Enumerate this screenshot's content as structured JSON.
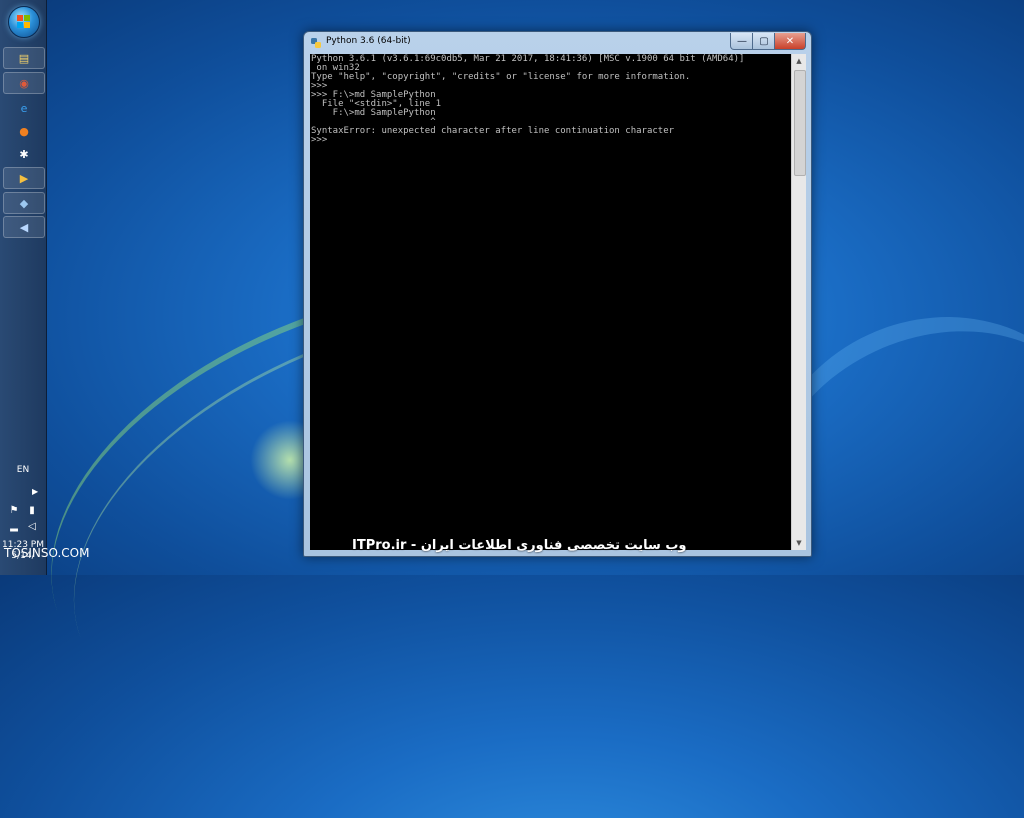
{
  "window": {
    "title": "Python 3.6 (64-bit)",
    "controls": {
      "minimize": "—",
      "maximize": "▢",
      "close": "✕"
    }
  },
  "console": {
    "lines": [
      "Python 3.6.1 (v3.6.1:69c0db5, Mar 21 2017, 18:41:36) [MSC v.1900 64 bit (AMD64)]",
      " on win32",
      "Type \"help\", \"copyright\", \"credits\" or \"license\" for more information.",
      ">>>",
      ">>> F:\\>md SamplePython",
      "  File \"<stdin>\", line 1",
      "    F:\\>md SamplePython",
      "                      ^",
      "SyntaxError: unexpected character after line continuation character",
      ">>>"
    ]
  },
  "taskbar": {
    "language": "EN",
    "clock_time": "11:23 PM",
    "clock_date": "5/14/",
    "pinned": [
      {
        "name": "explorer",
        "glyph": "▤"
      },
      {
        "name": "chrome",
        "glyph": "◉"
      },
      {
        "name": "internet-explorer",
        "glyph": "e"
      },
      {
        "name": "firefox",
        "glyph": "●"
      },
      {
        "name": "tool",
        "glyph": "✱"
      },
      {
        "name": "media-player",
        "glyph": "▶"
      },
      {
        "name": "network",
        "glyph": "◆"
      },
      {
        "name": "back",
        "glyph": "◀"
      }
    ]
  },
  "watermarks": {
    "left": "TOSINSO.COM",
    "center": "ITPro.ir - وب سایت تخصصی فناوری اطلاعات ایران"
  }
}
